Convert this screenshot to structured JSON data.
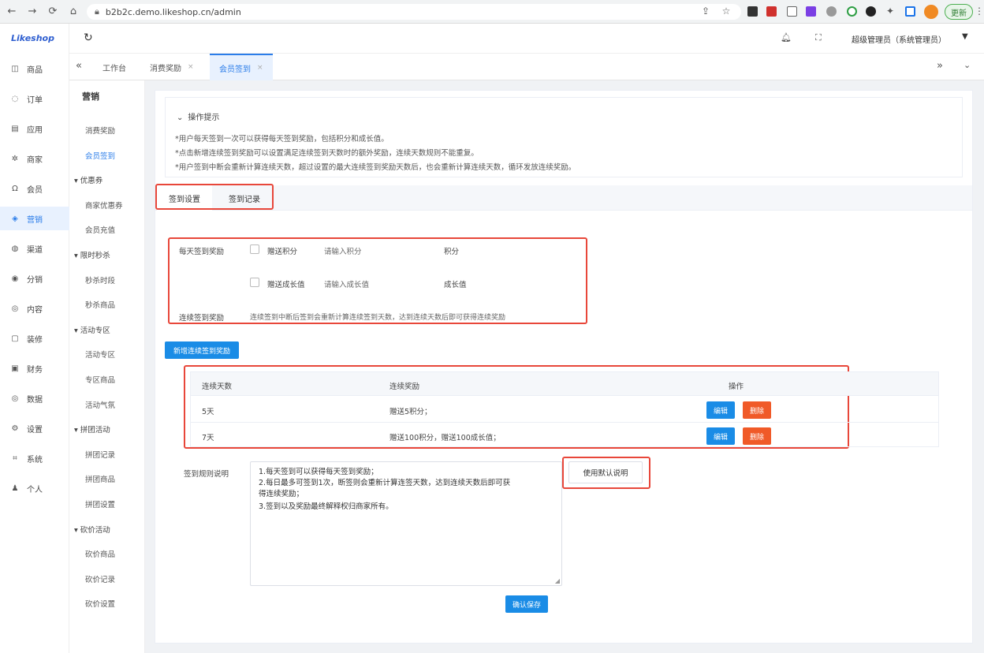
{
  "browser": {
    "url": "b2b2c.demo.likeshop.cn/admin",
    "update_label": "更新"
  },
  "app": {
    "logo": "Likeshop"
  },
  "sidebar": {
    "items": [
      {
        "label": "商品",
        "icon": "bag-icon"
      },
      {
        "label": "订单",
        "icon": "order-icon"
      },
      {
        "label": "应用",
        "icon": "app-icon"
      },
      {
        "label": "商家",
        "icon": "shop-icon"
      },
      {
        "label": "会员",
        "icon": "user-icon"
      },
      {
        "label": "营销",
        "icon": "marketing-icon"
      },
      {
        "label": "渠道",
        "icon": "channel-icon"
      },
      {
        "label": "分销",
        "icon": "distribution-icon"
      },
      {
        "label": "内容",
        "icon": "content-icon"
      },
      {
        "label": "装修",
        "icon": "decorate-icon"
      },
      {
        "label": "财务",
        "icon": "finance-icon"
      },
      {
        "label": "数据",
        "icon": "data-icon"
      },
      {
        "label": "设置",
        "icon": "settings-icon"
      },
      {
        "label": "系统",
        "icon": "system-icon"
      },
      {
        "label": "个人",
        "icon": "person-icon"
      }
    ]
  },
  "header": {
    "user": "超级管理员（系统管理员）"
  },
  "tabs": [
    {
      "label": "工作台"
    },
    {
      "label": "消费奖励"
    },
    {
      "label": "会员签到"
    }
  ],
  "subnav": {
    "title": "营销",
    "items": [
      {
        "label": "消费奖励",
        "type": "item"
      },
      {
        "label": "会员签到",
        "type": "item",
        "active": true
      },
      {
        "label": "优惠券",
        "type": "group"
      },
      {
        "label": "商家优惠券",
        "type": "item"
      },
      {
        "label": "会员充值",
        "type": "item"
      },
      {
        "label": "限时秒杀",
        "type": "group"
      },
      {
        "label": "秒杀时段",
        "type": "item"
      },
      {
        "label": "秒杀商品",
        "type": "item"
      },
      {
        "label": "活动专区",
        "type": "group"
      },
      {
        "label": "活动专区",
        "type": "item"
      },
      {
        "label": "专区商品",
        "type": "item"
      },
      {
        "label": "活动气氛",
        "type": "item"
      },
      {
        "label": "拼团活动",
        "type": "group"
      },
      {
        "label": "拼团记录",
        "type": "item"
      },
      {
        "label": "拼团商品",
        "type": "item"
      },
      {
        "label": "拼团设置",
        "type": "item"
      },
      {
        "label": "砍价活动",
        "type": "group"
      },
      {
        "label": "砍价商品",
        "type": "item"
      },
      {
        "label": "砍价记录",
        "type": "item"
      },
      {
        "label": "砍价设置",
        "type": "item"
      }
    ]
  },
  "tips": {
    "title": "操作提示",
    "lines": [
      "*用户每天签到一次可以获得每天签到奖励，包括积分和成长值。",
      "*点击新增连续签到奖励可以设置满足连续签到天数时的额外奖励，连续天数规则不能重复。",
      "*用户签到中断会重新计算连续天数，超过设置的最大连续签到奖励天数后，也会重新计算连续天数，循环发放连续奖励。"
    ]
  },
  "subtabs": {
    "settings": "签到设置",
    "records": "签到记录"
  },
  "form": {
    "daily_label": "每天签到奖励",
    "points_chk": "赠送积分",
    "points_ph": "请输入积分",
    "points_unit": "积分",
    "growth_chk": "赠送成长值",
    "growth_ph": "请输入成长值",
    "growth_unit": "成长值",
    "continuous_label": "连续签到奖励",
    "continuous_hint": "连续签到中断后签到会重新计算连续签到天数，达到连续天数后即可获得连续奖励",
    "add_btn": "新增连续签到奖励",
    "rule_label": "签到规则说明",
    "rule_lines": [
      "1.每天签到可以获得每天签到奖励；",
      "2.每日最多可签到1次，断签则会重新计算连签天数，达到连续天数后即可获",
      "得连续奖励；",
      "3.签到以及奖励最终解释权归商家所有。"
    ],
    "default_btn": "使用默认说明",
    "save_btn": "确认保存"
  },
  "table": {
    "headers": [
      "连续天数",
      "连续奖励",
      "操作"
    ],
    "rows": [
      {
        "days": "5天",
        "reward": "赠送5积分；"
      },
      {
        "days": "7天",
        "reward": "赠送100积分，赠送100成长值；"
      }
    ],
    "edit_label": "编辑",
    "delete_label": "删除"
  }
}
